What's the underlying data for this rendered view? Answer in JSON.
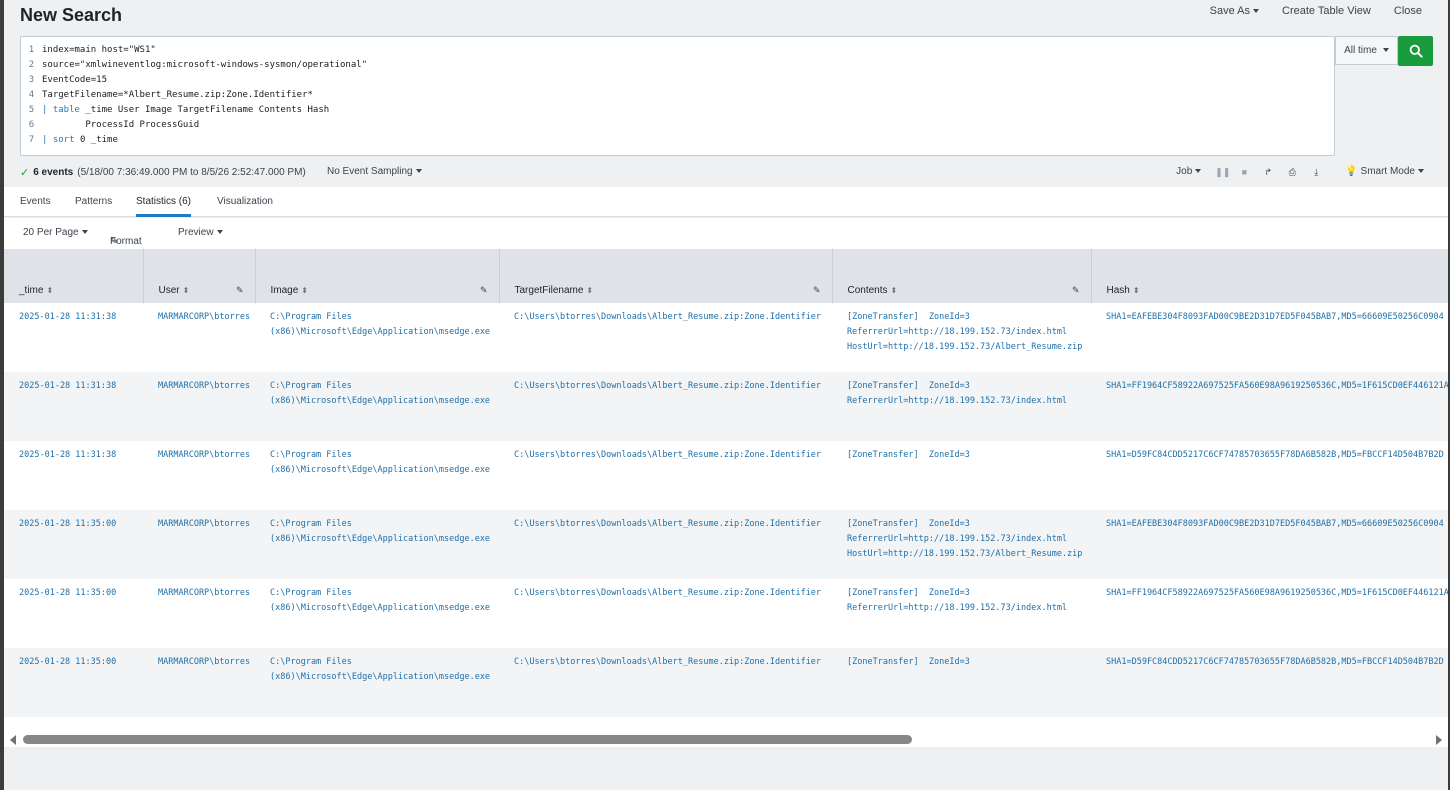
{
  "header": {
    "title": "New Search",
    "save_as": "Save As",
    "create_table_view": "Create Table View",
    "close": "Close"
  },
  "search": {
    "lines": [
      {
        "num": "1",
        "text": "index=main host=\"WS1\""
      },
      {
        "num": "2",
        "text": "source=\"xmlwineventlog:microsoft-windows-sysmon/operational\""
      },
      {
        "num": "3",
        "text": "EventCode=15"
      },
      {
        "num": "4",
        "text": "TargetFilename=*Albert_Resume.zip:Zone.Identifier*"
      },
      {
        "num": "5",
        "pipe": "| ",
        "keyword": "table",
        "text": " _time User Image TargetFilename Contents Hash"
      },
      {
        "num": "6",
        "text": "        ProcessId ProcessGuid"
      },
      {
        "num": "7",
        "pipe": "| ",
        "keyword": "sort",
        "text": " 0 _time"
      }
    ],
    "time_range": "All time",
    "search_icon": "search-icon"
  },
  "status": {
    "count": "6 events",
    "range": "(5/18/00 7:36:49.000 PM to 8/5/26 2:52:47.000 PM)",
    "sampling": "No Event Sampling",
    "job": "Job",
    "mode": "Smart Mode"
  },
  "tabs": [
    "Events",
    "Patterns",
    "Statistics (6)",
    "Visualization"
  ],
  "toolbar": {
    "per_page": "20 Per Page",
    "format": "Format",
    "preview": "Preview"
  },
  "table": {
    "columns": [
      "_time",
      "User",
      "Image",
      "TargetFilename",
      "Contents",
      "Hash"
    ],
    "rows": [
      {
        "time": "2025-01-28 11:31:38",
        "user": "MARMARCORP\\btorres",
        "image": "C:\\Program Files\n(x86)\\Microsoft\\Edge\\Application\\msedge.exe",
        "target": "C:\\Users\\btorres\\Downloads\\Albert_Resume.zip:Zone.Identifier",
        "contents": "[ZoneTransfer]  ZoneId=3\nReferrerUrl=http://18.199.152.73/index.html\nHostUrl=http://18.199.152.73/Albert_Resume.zip",
        "hash": "SHA1=EAFEBE304F8093FAD00C9BE2D31D7ED5F045BAB7,MD5=66609E50256C0904"
      },
      {
        "time": "2025-01-28 11:31:38",
        "user": "MARMARCORP\\btorres",
        "image": "C:\\Program Files\n(x86)\\Microsoft\\Edge\\Application\\msedge.exe",
        "target": "C:\\Users\\btorres\\Downloads\\Albert_Resume.zip:Zone.Identifier",
        "contents": "[ZoneTransfer]  ZoneId=3\nReferrerUrl=http://18.199.152.73/index.html",
        "hash": "SHA1=FF1964CF58922A697525FA560E98A9619250536C,MD5=1F615CD0EF446121A"
      },
      {
        "time": "2025-01-28 11:31:38",
        "user": "MARMARCORP\\btorres",
        "image": "C:\\Program Files\n(x86)\\Microsoft\\Edge\\Application\\msedge.exe",
        "target": "C:\\Users\\btorres\\Downloads\\Albert_Resume.zip:Zone.Identifier",
        "contents": "[ZoneTransfer]  ZoneId=3",
        "hash": "SHA1=D59FC84CDD5217C6CF74785703655F78DA6B582B,MD5=FBCCF14D504B7B2D"
      },
      {
        "time": "2025-01-28 11:35:00",
        "user": "MARMARCORP\\btorres",
        "image": "C:\\Program Files\n(x86)\\Microsoft\\Edge\\Application\\msedge.exe",
        "target": "C:\\Users\\btorres\\Downloads\\Albert_Resume.zip:Zone.Identifier",
        "contents": "[ZoneTransfer]  ZoneId=3\nReferrerUrl=http://18.199.152.73/index.html\nHostUrl=http://18.199.152.73/Albert_Resume.zip",
        "hash": "SHA1=EAFEBE304F8093FAD00C9BE2D31D7ED5F045BAB7,MD5=66609E50256C0904"
      },
      {
        "time": "2025-01-28 11:35:00",
        "user": "MARMARCORP\\btorres",
        "image": "C:\\Program Files\n(x86)\\Microsoft\\Edge\\Application\\msedge.exe",
        "target": "C:\\Users\\btorres\\Downloads\\Albert_Resume.zip:Zone.Identifier",
        "contents": "[ZoneTransfer]  ZoneId=3\nReferrerUrl=http://18.199.152.73/index.html",
        "hash": "SHA1=FF1964CF58922A697525FA560E98A9619250536C,MD5=1F615CD0EF446121A"
      },
      {
        "time": "2025-01-28 11:35:00",
        "user": "MARMARCORP\\btorres",
        "image": "C:\\Program Files\n(x86)\\Microsoft\\Edge\\Application\\msedge.exe",
        "target": "C:\\Users\\btorres\\Downloads\\Albert_Resume.zip:Zone.Identifier",
        "contents": "[ZoneTransfer]  ZoneId=3",
        "hash": "SHA1=D59FC84CDD5217C6CF74785703655F78DA6B582B,MD5=FBCCF14D504B7B2D"
      }
    ]
  },
  "colors": {
    "link": "#1f6fa8",
    "search_button": "#1a9c3e",
    "tab_underline": "#1f7abf"
  }
}
